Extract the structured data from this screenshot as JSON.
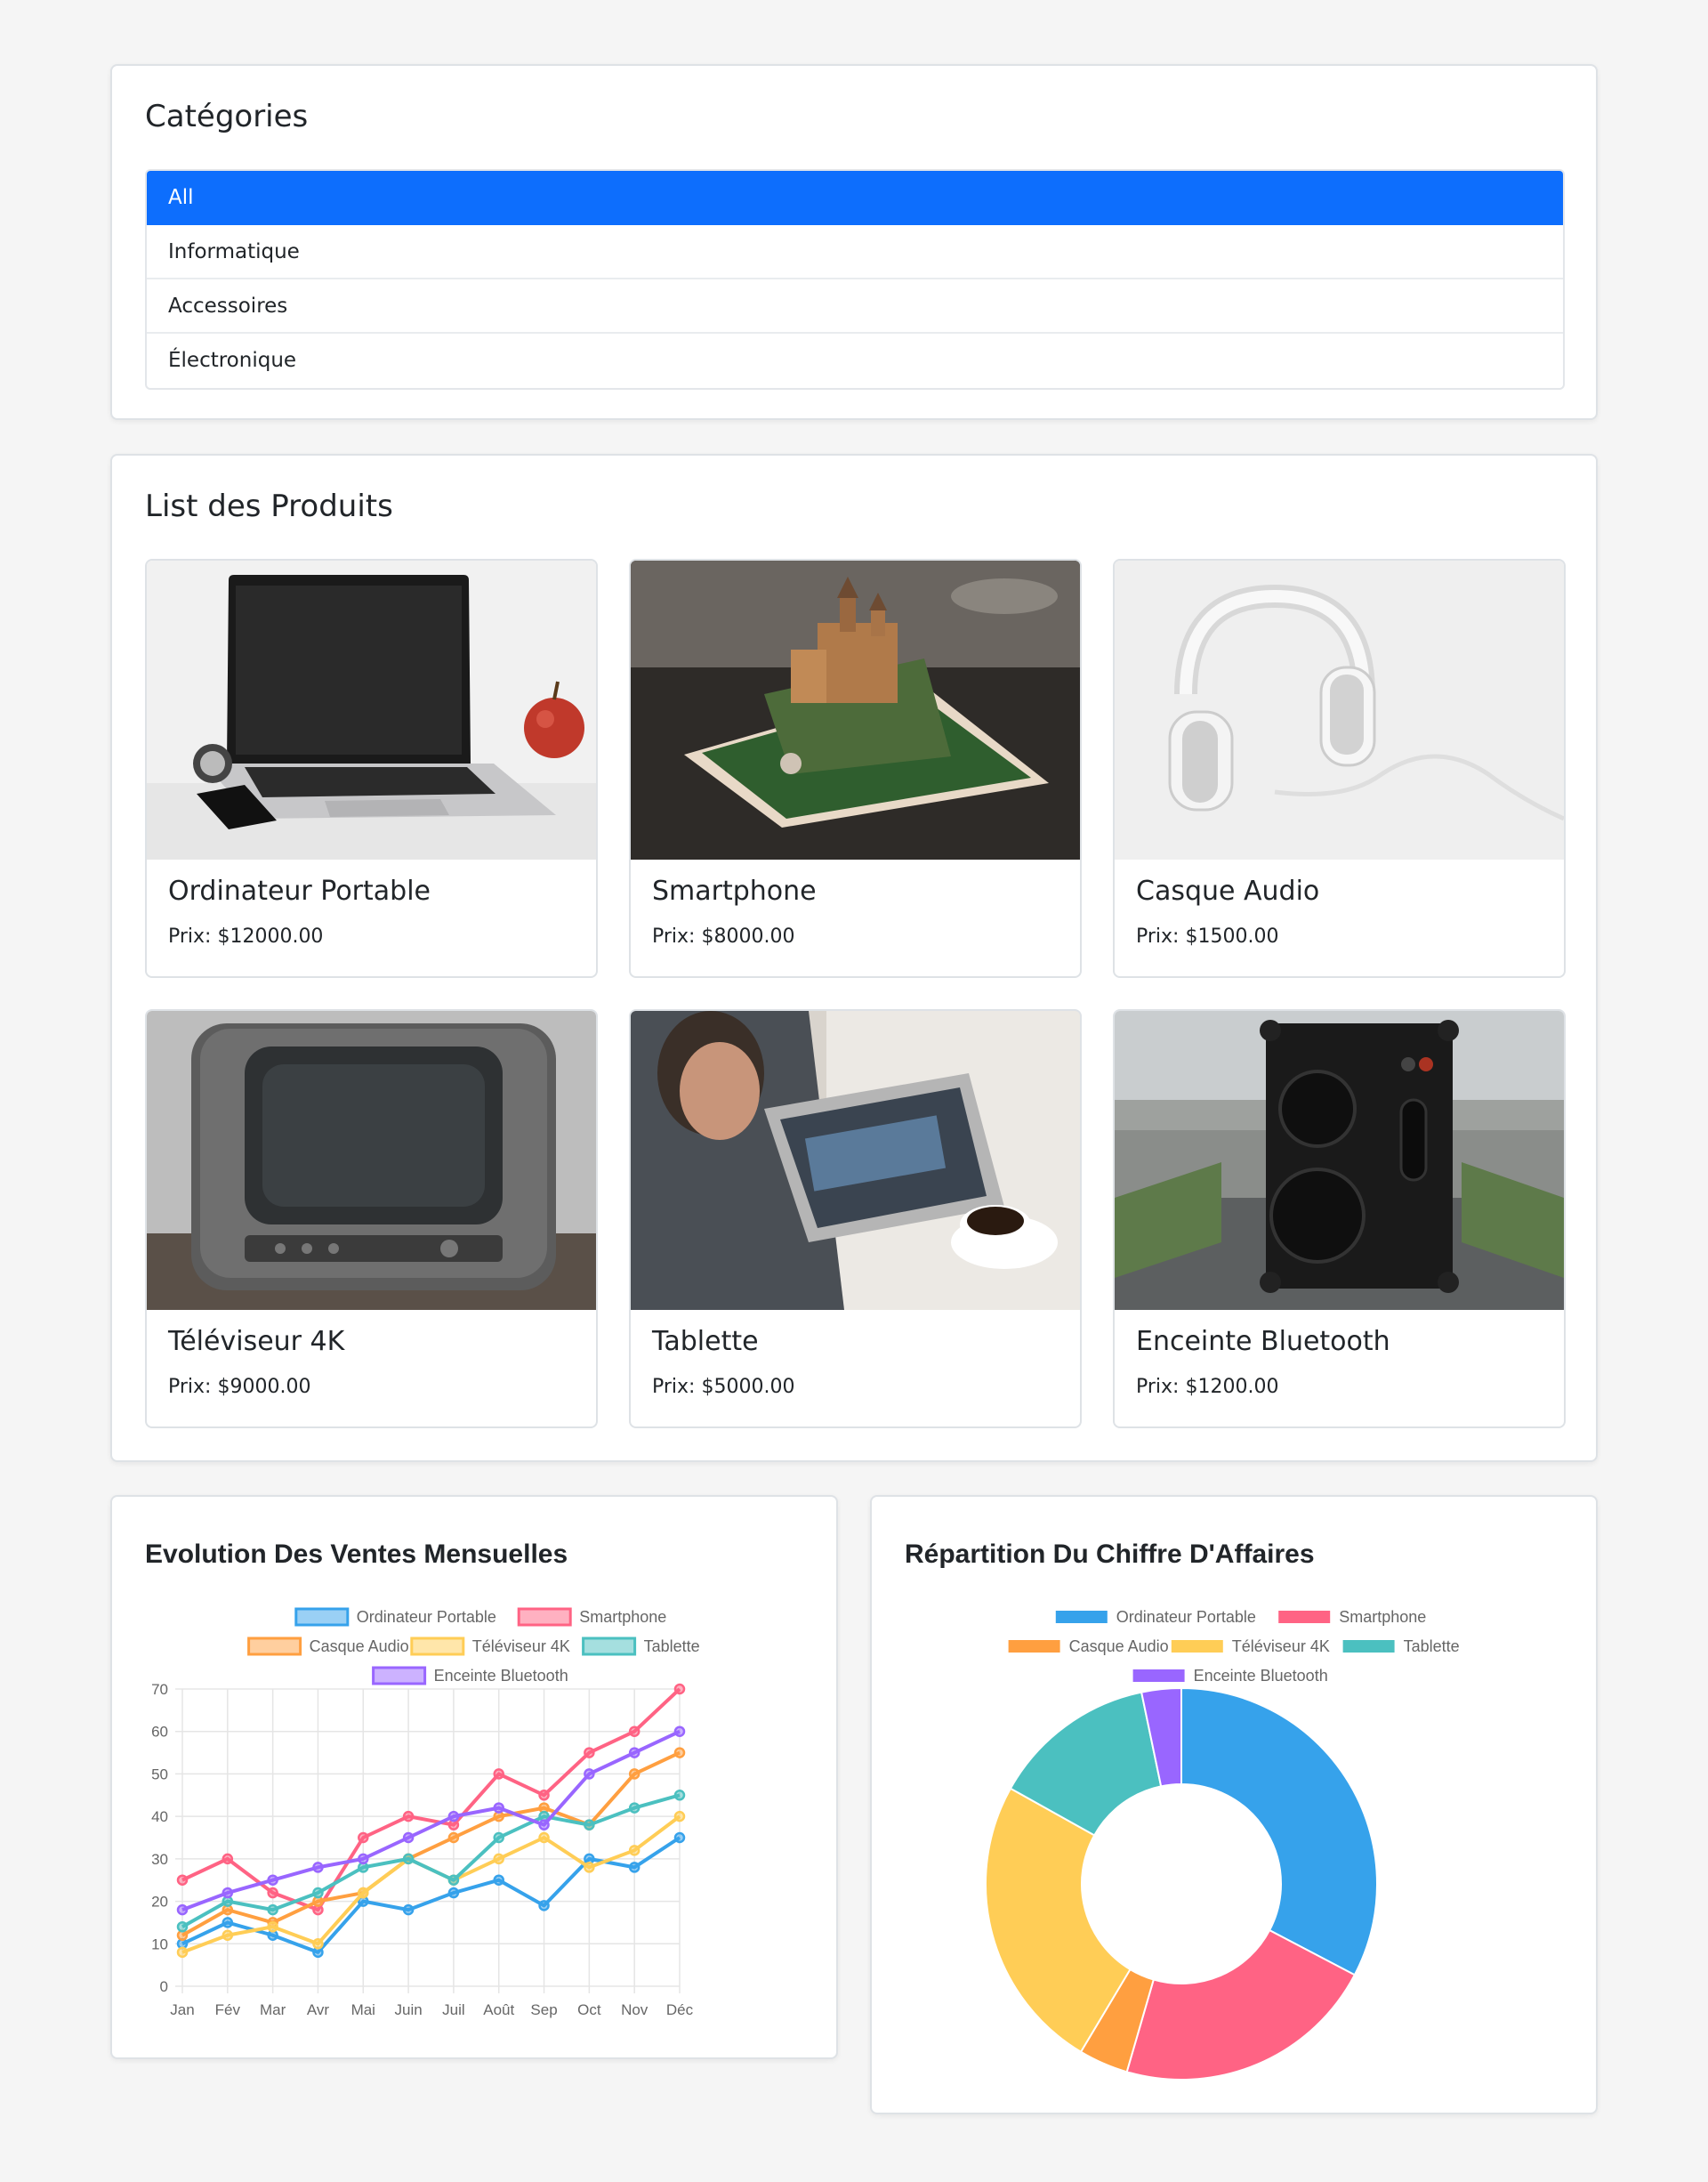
{
  "categories": {
    "title": "Catégories",
    "items": [
      {
        "label": "All",
        "active": true
      },
      {
        "label": "Informatique",
        "active": false
      },
      {
        "label": "Accessoires",
        "active": false
      },
      {
        "label": "Électronique",
        "active": false
      }
    ]
  },
  "products": {
    "title": "List des Produits",
    "items": [
      {
        "name": "Ordinateur Portable",
        "price": "Prix: $12000.00",
        "image": "laptop-image"
      },
      {
        "name": "Smartphone",
        "price": "Prix: $8000.00",
        "image": "smartphone-image"
      },
      {
        "name": "Casque Audio",
        "price": "Prix: $1500.00",
        "image": "headphones-image"
      },
      {
        "name": "Téléviseur 4K",
        "price": "Prix: $9000.00",
        "image": "tv-image"
      },
      {
        "name": "Tablette",
        "price": "Prix: $5000.00",
        "image": "tablet-image"
      },
      {
        "name": "Enceinte Bluetooth",
        "price": "Prix: $1200.00",
        "image": "speaker-image"
      }
    ]
  },
  "chart_data": [
    {
      "type": "line",
      "title": "Evolution Des Ventes Mensuelles",
      "x": [
        "Jan",
        "Fév",
        "Mar",
        "Avr",
        "Mai",
        "Juin",
        "Juil",
        "Août",
        "Sep",
        "Oct",
        "Nov",
        "Déc"
      ],
      "ylim": [
        0,
        70
      ],
      "yticks": [
        0,
        10,
        20,
        30,
        40,
        50,
        60,
        70
      ],
      "grid": true,
      "legend": "top",
      "series": [
        {
          "name": "Ordinateur Portable",
          "color": "#36a2eb",
          "values": [
            10,
            15,
            12,
            8,
            20,
            18,
            22,
            25,
            19,
            30,
            28,
            35
          ]
        },
        {
          "name": "Smartphone",
          "color": "#ff6384",
          "values": [
            25,
            30,
            22,
            18,
            35,
            40,
            38,
            50,
            45,
            55,
            60,
            70
          ]
        },
        {
          "name": "Casque Audio",
          "color": "#ff9f40",
          "values": [
            12,
            18,
            15,
            20,
            22,
            30,
            35,
            40,
            42,
            38,
            50,
            55
          ]
        },
        {
          "name": "Téléviseur 4K",
          "color": "#ffcd56",
          "values": [
            8,
            12,
            14,
            10,
            22,
            30,
            25,
            30,
            35,
            28,
            32,
            40
          ]
        },
        {
          "name": "Tablette",
          "color": "#4bc0c0",
          "values": [
            14,
            20,
            18,
            22,
            28,
            30,
            25,
            35,
            40,
            38,
            42,
            45
          ]
        },
        {
          "name": "Enceinte Bluetooth",
          "color": "#9966ff",
          "values": [
            18,
            22,
            25,
            28,
            30,
            35,
            40,
            42,
            38,
            50,
            55,
            60
          ]
        }
      ]
    },
    {
      "type": "pie",
      "title": "Répartition Du Chiffre D'Affaires",
      "legend": "top",
      "categories": [
        "Ordinateur Portable",
        "Smartphone",
        "Casque Audio",
        "Téléviseur 4K",
        "Tablette",
        "Enceinte Bluetooth"
      ],
      "values": [
        12000,
        8000,
        1500,
        9000,
        5000,
        1200
      ],
      "colors": [
        "#36a2eb",
        "#ff6384",
        "#ff9f40",
        "#ffcd56",
        "#4bc0c0",
        "#9966ff"
      ]
    }
  ]
}
